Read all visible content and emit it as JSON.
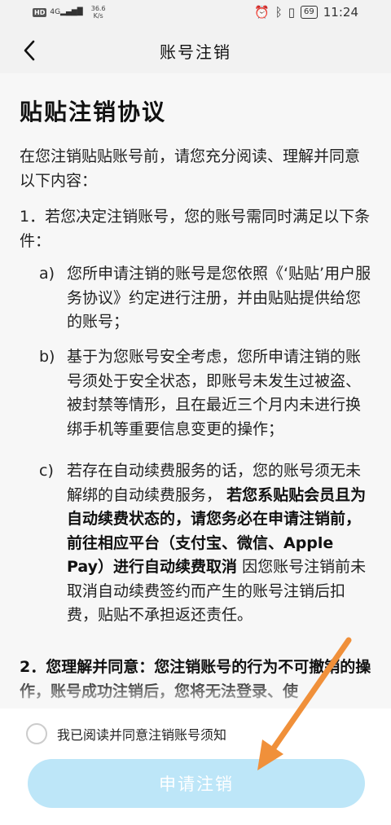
{
  "status_bar": {
    "hd": "HD",
    "network": "4G",
    "speed_value": "36.6",
    "speed_unit": "K/s",
    "battery": "69",
    "time": "11:24"
  },
  "nav": {
    "title": "账号注销",
    "back_icon": "chevron-left-icon"
  },
  "agreement": {
    "heading": "贴贴注销协议",
    "intro": "在您注销贴贴账号前，请您充分阅读、理解并同意以下内容：",
    "point1": "1．若您决定注销账号，您的账号需同时满足以下条件：",
    "items": [
      {
        "marker": "a)",
        "text": "您所申请注销的账号是您依照《‘贴贴’用户服务协议》约定进行注册，并由贴贴提供给您的账号；"
      },
      {
        "marker": "b)",
        "text": "基于为您账号安全考虑，您所申请注销的账号须处于安全状态，即账号未发生过被盗、被封禁等情形，且在最近三个月内未进行换绑手机等重要信息变更的操作；"
      },
      {
        "marker": "c)",
        "text_normal_1": "若存在自动续费服务的话，您的账号须无未解绑的自动续费服务，",
        "text_bold": "若您系贴贴会员且为自动续费状态的，请您务必在申请注销前，前往相应平台（支付宝、微信、Apple Pay）进行自动续费取消",
        "text_normal_2": "因您账号注销前未取消自动续费签约而产生的账号注销后扣费，贴贴不承担返还责任。"
      }
    ],
    "point2": "2．您理解并同意：您注销账号的行为不可撤销的操作，账号成功注销后，您将无法登录、使"
  },
  "footer": {
    "agree_label": "我已阅读并同意注销账号须知",
    "apply_label": "申请注销"
  },
  "colors": {
    "button_bg": "#bde6f8",
    "annotation_arrow": "#f0903a"
  }
}
